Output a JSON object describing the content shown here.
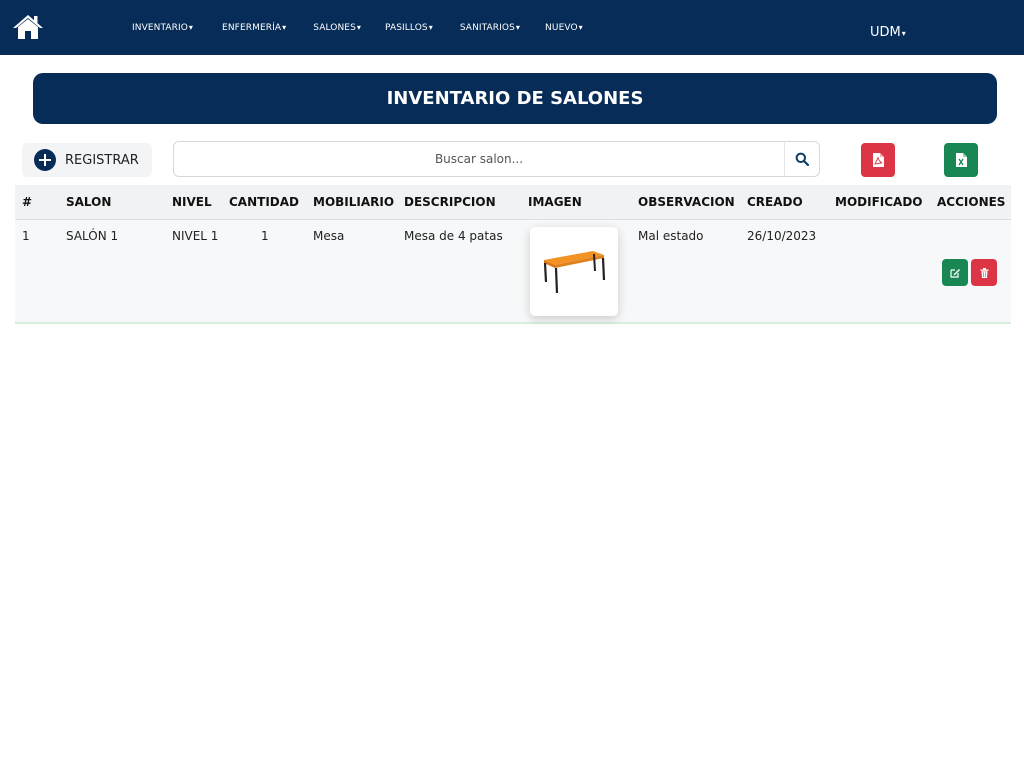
{
  "colors": {
    "navbar_bg": "#062c57",
    "banner_bg": "#062c57",
    "pdf_button": "#dc3545",
    "excel_button": "#198754",
    "edit_button": "#198754",
    "delete_button": "#dc3545"
  },
  "navbar": {
    "home_icon": "home-icon",
    "menu": [
      {
        "label": "INVENTARIO"
      },
      {
        "label": "ENFERMERÍA"
      },
      {
        "label": "SALONES"
      },
      {
        "label": "PASILLOS"
      },
      {
        "label": "SANITARIOS"
      },
      {
        "label": "NUEVO"
      }
    ],
    "caret": "▾",
    "user_label": "UDM"
  },
  "page": {
    "title": "INVENTARIO DE SALONES"
  },
  "toolbar": {
    "register_label": "REGISTRAR",
    "register_icon": "plus-circle-icon",
    "search_placeholder": "Buscar salon...",
    "search_value": "",
    "search_icon": "search-icon",
    "pdf_icon": "pdf-file-icon",
    "excel_icon": "excel-file-icon"
  },
  "table": {
    "headers": [
      "#",
      "SALON",
      "NIVEL",
      "CANTIDAD",
      "MOBILIARIO",
      "DESCRIPCION",
      "IMAGEN",
      "OBSERVACION",
      "CREADO",
      "MODIFICADO",
      "ACCIONES"
    ],
    "rows": [
      {
        "id": "1",
        "salon": "SALÓN 1",
        "nivel": "NIVEL 1",
        "cantidad": "1",
        "mobiliario": "Mesa",
        "descripcion": "Mesa de 4 patas",
        "imagen": "table-furniture-image",
        "observacion": "Mal estado",
        "creado": "26/10/2023",
        "modificado": "",
        "edit_icon": "edit-icon",
        "delete_icon": "trash-icon"
      }
    ]
  }
}
